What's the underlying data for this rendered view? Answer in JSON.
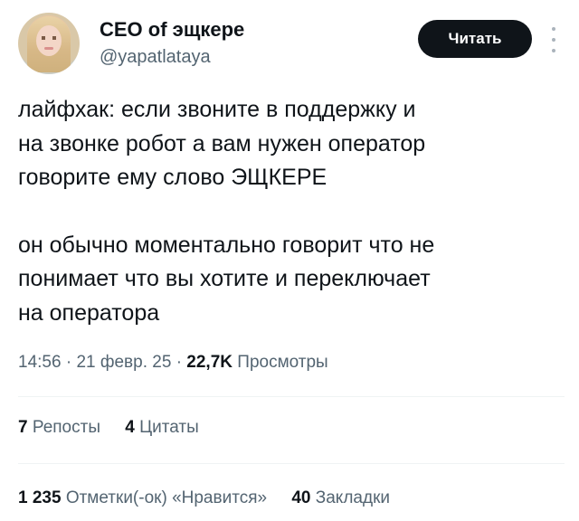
{
  "author": {
    "display_name": "CEO of эщкере",
    "handle": "@yapatlataya"
  },
  "follow_button": {
    "label": "Читать"
  },
  "more_icon": "more-vertical-icon",
  "tweet": {
    "paragraphs": [
      [
        "лайфхак: если звоните в поддержку и",
        "на звонке робот а вам нужен оператор",
        "говорите ему слово ЭЩКЕРЕ"
      ],
      [
        "он обычно моментально говорит что не",
        "понимает что вы хотите и переключает",
        "на оператора"
      ]
    ]
  },
  "meta": {
    "time": "14:56",
    "separator": "·",
    "date": "21 февр. 25",
    "views_count": "22,7K",
    "views_label": "Просмотры"
  },
  "stats": {
    "reposts": {
      "count": "7",
      "label": "Репосты"
    },
    "quotes": {
      "count": "4",
      "label": "Цитаты"
    },
    "likes": {
      "count": "1 235",
      "label": "Отметки(-ок) «Нравится»"
    },
    "bookmarks": {
      "count": "40",
      "label": "Закладки"
    }
  },
  "colors": {
    "text_primary": "#0f1419",
    "text_secondary": "#536471",
    "button_bg": "#0f1419",
    "divider": "#eff3f4"
  }
}
